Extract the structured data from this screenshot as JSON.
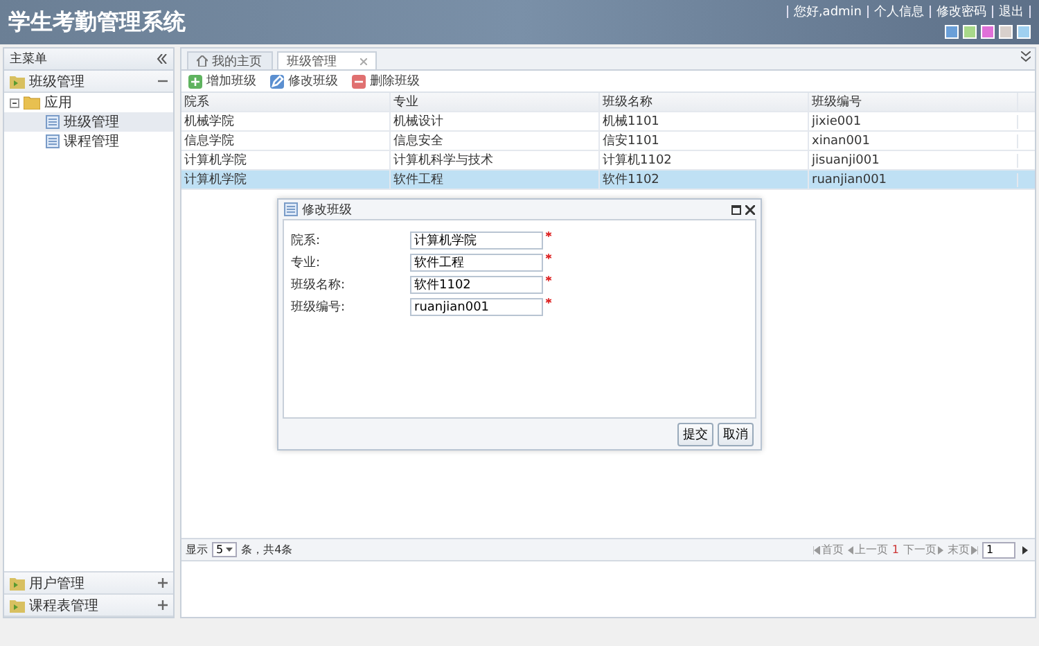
{
  "header": {
    "title": "学生考勤管理系统",
    "links": [
      "您好,admin",
      "个人信息",
      "修改密码",
      "退出"
    ],
    "themes": [
      {
        "color": "#6a9fd8"
      },
      {
        "color": "#a8d88a"
      },
      {
        "color": "#e070d8"
      },
      {
        "color": "#d8d0cc"
      },
      {
        "color": "#9fd0f0"
      }
    ]
  },
  "sidebar": {
    "title": "主菜单",
    "sections": [
      {
        "label": "班级管理",
        "expanded": true,
        "tree": [
          {
            "label": "应用",
            "expanded": true,
            "children": [
              {
                "label": "班级管理",
                "selected": true
              },
              {
                "label": "课程管理",
                "selected": false
              }
            ]
          }
        ]
      },
      {
        "label": "用户管理",
        "expanded": false
      },
      {
        "label": "课程表管理",
        "expanded": false
      }
    ]
  },
  "tabs": [
    {
      "label": "我的主页",
      "selected": false,
      "kind": "home"
    },
    {
      "label": "班级管理",
      "selected": true,
      "kind": "closable"
    }
  ],
  "toolbar": [
    {
      "label": "增加班级",
      "kind": "add"
    },
    {
      "label": "修改班级",
      "kind": "edit"
    },
    {
      "label": "删除班级",
      "kind": "delete"
    }
  ],
  "table": {
    "columns": [
      "院系",
      "专业",
      "班级名称",
      "班级编号"
    ],
    "rows": [
      {
        "cells": [
          "机械学院",
          "机械设计",
          "机械1101",
          "jixie001"
        ],
        "selected": false
      },
      {
        "cells": [
          "信息学院",
          "信息安全",
          "信安1101",
          "xinan001"
        ],
        "selected": false
      },
      {
        "cells": [
          "计算机学院",
          "计算机科学与技术",
          "计算机1102",
          "jisuanji001"
        ],
        "selected": false
      },
      {
        "cells": [
          "计算机学院",
          "软件工程",
          "软件1102",
          "ruanjian001"
        ],
        "selected": true
      }
    ]
  },
  "pager": {
    "show_label": "显示",
    "page_size": "5",
    "summary": "条，共4条",
    "first": "首页",
    "prev": "上一页",
    "current": "1",
    "next": "下一页",
    "last": "末页",
    "page_input": "1"
  },
  "dialog": {
    "title": "修改班级",
    "fields": [
      {
        "label": "院系:",
        "value": "计算机学院",
        "required": true
      },
      {
        "label": "专业:",
        "value": "软件工程",
        "required": true
      },
      {
        "label": "班级名称:",
        "value": "软件1102",
        "required": true
      },
      {
        "label": "班级编号:",
        "value": "ruanjian001",
        "required": true
      }
    ],
    "buttons": [
      "提交",
      "取消"
    ]
  }
}
